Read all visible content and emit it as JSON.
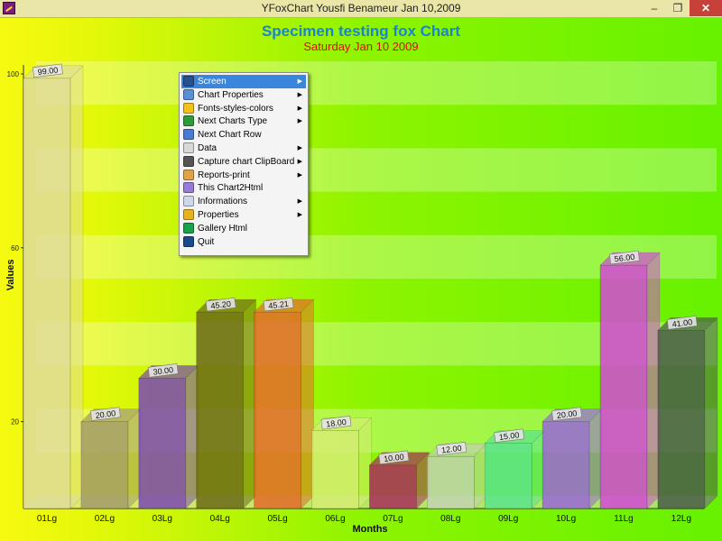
{
  "window": {
    "title": "YFoxChart   Yousfi  Benameur Jan 10,2009",
    "min_glyph": "–",
    "max_glyph": "❐",
    "close_glyph": "✕"
  },
  "chart_data": {
    "type": "bar",
    "title": "Specimen testing fox Chart",
    "subtitle": "Saturday Jan 10 2009",
    "xlabel": "Months",
    "ylabel": "Values",
    "ylim": [
      0,
      100
    ],
    "yticks": [
      20,
      60,
      100
    ],
    "categories": [
      "01Lg",
      "02Lg",
      "03Lg",
      "04Lg",
      "05Lg",
      "06Lg",
      "07Lg",
      "08Lg",
      "09Lg",
      "10Lg",
      "11Lg",
      "12Lg"
    ],
    "values": [
      99.0,
      20.0,
      30.0,
      45.2,
      45.21,
      18.0,
      10.0,
      12.0,
      15.0,
      20.0,
      56.0,
      41.0
    ],
    "value_labels": [
      "99.00",
      "20.00",
      "30.00",
      "45.20",
      "45.21",
      "18.00",
      "10.00",
      "12.00",
      "15.00",
      "20.00",
      "56.00",
      "41.00"
    ],
    "bar_colors": [
      "#dedc9c",
      "#a29a6a",
      "#7a48b2",
      "#6b6818",
      "#e26a2a",
      "#d6ec74",
      "#a82c5c",
      "#c2d2b2",
      "#5ae28e",
      "#9a66d8",
      "#d448d8",
      "#4a5a4a"
    ],
    "title_color": "#1a84d2",
    "subtitle_color": "#d41212"
  },
  "menu": {
    "items": [
      {
        "label": "Screen",
        "icon": "screen-icon",
        "color": "#2a4f8a",
        "submenu": true,
        "selected": true
      },
      {
        "label": "Chart Properties",
        "icon": "magnifier-icon",
        "color": "#5b8fd6",
        "submenu": true
      },
      {
        "label": "Fonts-styles-colors",
        "icon": "star-icon",
        "color": "#f2c21a",
        "submenu": true
      },
      {
        "label": "Next Charts Type",
        "icon": "flag-icon",
        "color": "#2e9a3a",
        "submenu": true
      },
      {
        "label": "Next Chart Row",
        "icon": "document-icon",
        "color": "#4a7ad2",
        "submenu": false
      },
      {
        "label": "Data",
        "icon": "calendar-icon",
        "color": "#d8d8d8",
        "submenu": true
      },
      {
        "label": "Capture chart ClipBoard",
        "icon": "camera-icon",
        "color": "#555555",
        "submenu": true
      },
      {
        "label": "Reports-print",
        "icon": "folder-icon",
        "color": "#e2a24a",
        "submenu": true
      },
      {
        "label": "This Chart2Html",
        "icon": "globe-icon",
        "color": "#9a7ad8",
        "submenu": false
      },
      {
        "label": "Informations",
        "icon": "page-icon",
        "color": "#cfd8ea",
        "submenu": true
      },
      {
        "label": "Properties",
        "icon": "shield-icon",
        "color": "#e8b21a",
        "submenu": true
      },
      {
        "label": "Gallery Html",
        "icon": "checkmark-icon",
        "color": "#1aa24a",
        "submenu": false
      },
      {
        "label": "Quit",
        "icon": "power-icon",
        "color": "#1a4a8a",
        "submenu": false
      }
    ],
    "arrow_glyph": "▶"
  }
}
